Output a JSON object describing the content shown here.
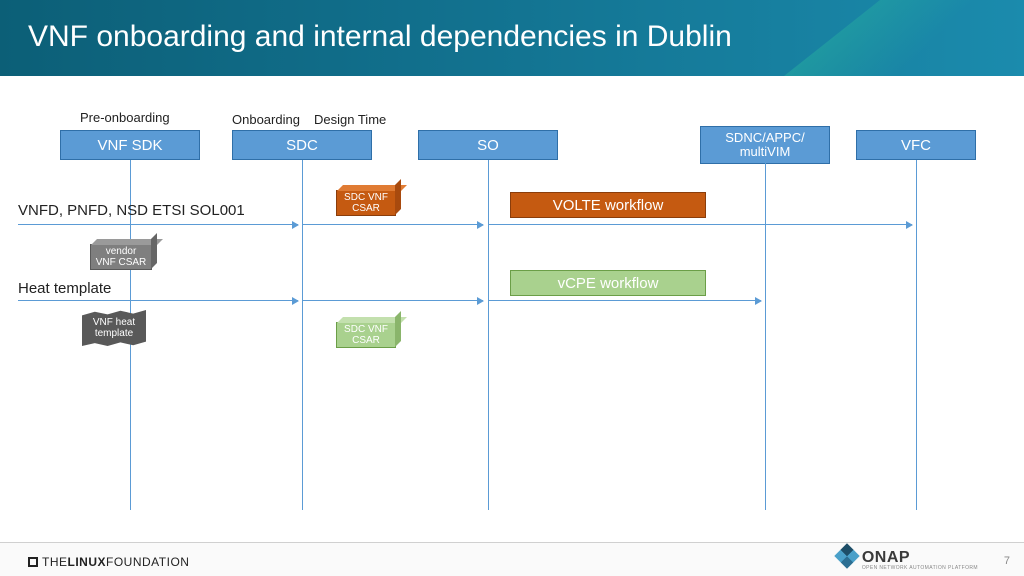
{
  "title": "VNF onboarding and internal dependencies in Dublin",
  "phases": {
    "pre": "Pre-onboarding",
    "onboard": "Onboarding",
    "design": "Design Time"
  },
  "lanes": {
    "vnfsdk": "VNF SDK",
    "sdc": "SDC",
    "so": "SO",
    "sdnc": "SDNC/APPC/\nmultiVIM",
    "vfc": "VFC"
  },
  "rows": {
    "row1": "VNFD, PNFD, NSD ETSI SOL001",
    "row2": "Heat template"
  },
  "artifacts": {
    "sdc_csar_orange": "SDC VNF\nCSAR",
    "vendor_csar": "vendor\nVNF CSAR",
    "sdc_csar_green": "SDC VNF\nCSAR",
    "vnf_heat": "VNF heat\ntemplate"
  },
  "workflows": {
    "volte": "VOLTE workflow",
    "vcpe": "vCPE workflow"
  },
  "footer": {
    "linux": "THE LINUX FOUNDATION",
    "onap": "ONAP",
    "onap_sub": "OPEN NETWORK AUTOMATION PLATFORM",
    "page": "7"
  }
}
